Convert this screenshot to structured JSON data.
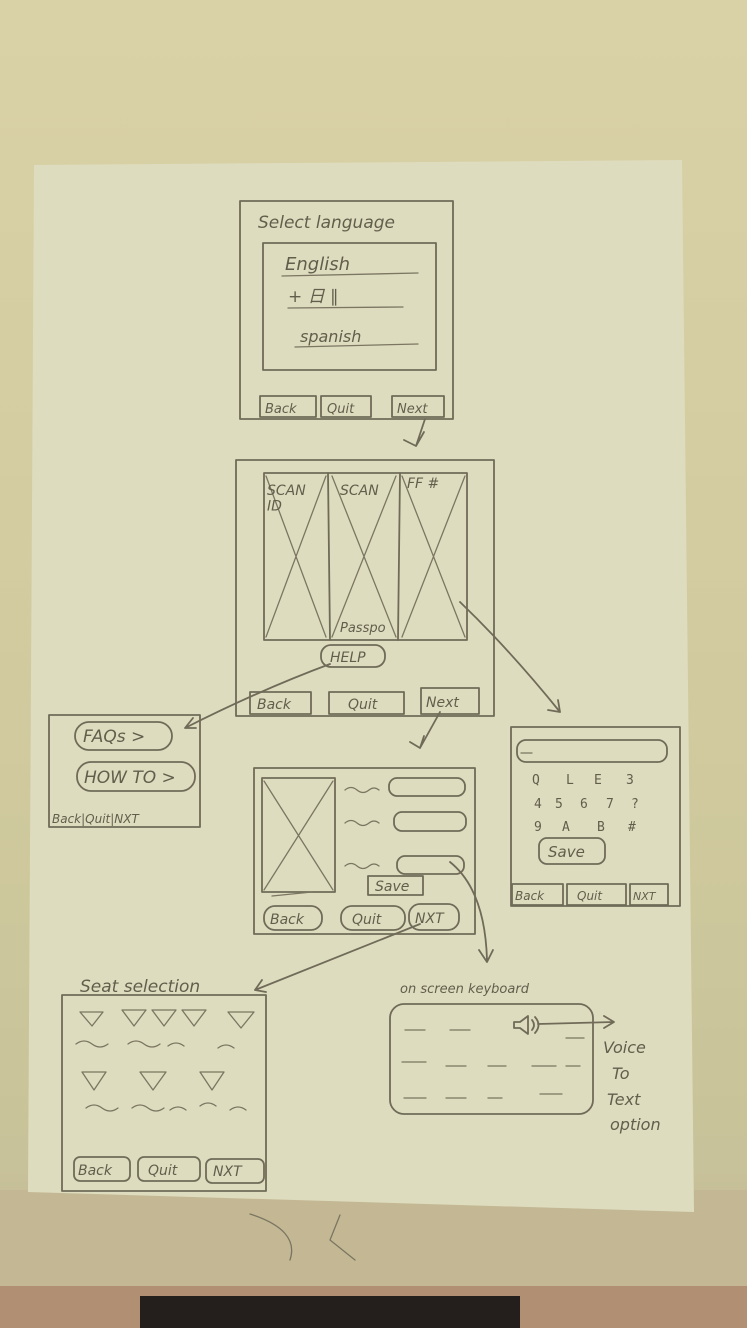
{
  "language_screen": {
    "title": "Select language",
    "options": [
      "English",
      "+ 日 ∥",
      "spanish"
    ],
    "buttons": [
      "Back",
      "Quit",
      "Next"
    ]
  },
  "scan_screen": {
    "panels": [
      "SCAN\nID",
      "SCAN",
      "FF #"
    ],
    "passport_label": "Passpo",
    "help_button": "HELP",
    "buttons": [
      "Back",
      "Quit",
      "Next"
    ]
  },
  "help_screen": {
    "items": [
      "FAQs >",
      "HOW TO >"
    ],
    "buttons": "Back|Quit|NXT"
  },
  "form_screen": {
    "save_button": "Save",
    "buttons": [
      "Back",
      "Quit",
      "NXT"
    ]
  },
  "keypad_screen": {
    "keys": [
      "Q",
      "L",
      "E",
      "3",
      "4",
      "5",
      "6",
      "7",
      "?",
      "9",
      "A",
      "B",
      "#"
    ],
    "save_button": "Save",
    "buttons": [
      "Back",
      "Quit",
      "NXT"
    ]
  },
  "seat_screen": {
    "title": "Seat selection",
    "buttons": [
      "Back",
      "Quit",
      "NXT"
    ]
  },
  "keyboard_note": {
    "title": "on screen keyboard",
    "voice_label": [
      "Voice",
      "To",
      "Text",
      "option"
    ]
  }
}
